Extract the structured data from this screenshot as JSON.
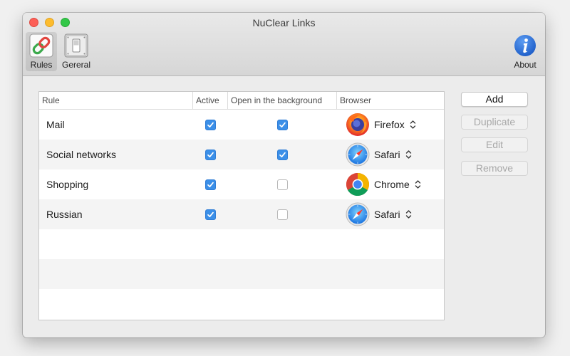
{
  "window": {
    "title": "NuClear Links"
  },
  "toolbar": {
    "rules_label": "Rules",
    "general_label": "Gereral",
    "about_label": "About"
  },
  "table": {
    "columns": [
      "Rule",
      "Active",
      "Open in the background",
      "Browser"
    ],
    "rows": [
      {
        "rule": "Mail",
        "active": true,
        "background": true,
        "browser": "Firefox",
        "browser_icon": "firefox-icon"
      },
      {
        "rule": "Social networks",
        "active": true,
        "background": true,
        "browser": "Safari",
        "browser_icon": "safari-icon"
      },
      {
        "rule": "Shopping",
        "active": true,
        "background": false,
        "browser": "Chrome",
        "browser_icon": "chrome-icon"
      },
      {
        "rule": "Russian",
        "active": true,
        "background": false,
        "browser": "Safari",
        "browser_icon": "safari-icon"
      }
    ]
  },
  "buttons": {
    "add": "Add",
    "duplicate": "Duplicate",
    "edit": "Edit",
    "remove": "Remove"
  },
  "colors": {
    "accent": "#3b8fe8",
    "about_icon": "#2f6fd6"
  }
}
